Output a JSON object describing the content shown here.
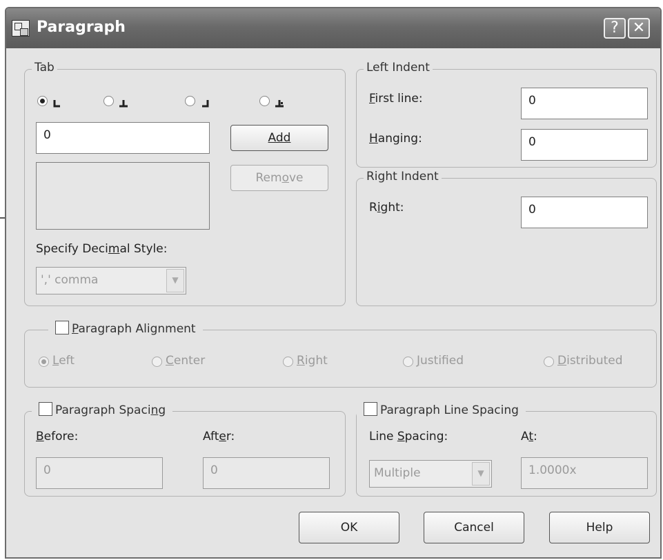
{
  "window": {
    "title": "Paragraph",
    "help": "?",
    "close": "✕"
  },
  "tab": {
    "legend": "Tab",
    "value": "0",
    "add": "Add",
    "remove_pre": "Rem",
    "remove_u": "o",
    "remove_post": "ve",
    "decimal_pre": "Specify Deci",
    "decimal_u": "m",
    "decimal_post": "al Style:",
    "decimal_value": "',' comma"
  },
  "left_indent": {
    "legend": "Left Indent",
    "first_u": "F",
    "first_rest": "irst line:",
    "first_value": "0",
    "hanging_u": "H",
    "hanging_rest": "anging:",
    "hanging_value": "0"
  },
  "right_indent": {
    "legend": "Right Indent",
    "right_pre": "R",
    "right_u": "i",
    "right_post": "ght:",
    "right_value": "0"
  },
  "alignment": {
    "title_u": "P",
    "title_rest": "aragraph Alignment",
    "left_u": "L",
    "left_rest": "eft",
    "center_u": "C",
    "center_rest": "enter",
    "right_u": "R",
    "right_rest": "ight",
    "justified_u": "J",
    "justified_rest": "ustified",
    "distributed_u": "D",
    "distributed_rest": "istributed"
  },
  "spacing": {
    "title_pre": "Paragraph Spaci",
    "title_u": "n",
    "title_post": "g",
    "before_u": "B",
    "before_rest": "efore:",
    "before_value": "0",
    "after_pre": "Aft",
    "after_u": "e",
    "after_post": "r:",
    "after_value": "0"
  },
  "line_spacing": {
    "title": "Paragraph Line Spacing",
    "label_pre": "Line ",
    "label_u": "S",
    "label_post": "pacing:",
    "at_pre": "A",
    "at_u": "t",
    "at_post": ":",
    "mode": "Multiple",
    "at_value": "1.0000x"
  },
  "footer": {
    "ok": "OK",
    "cancel": "Cancel",
    "help": "Help"
  }
}
